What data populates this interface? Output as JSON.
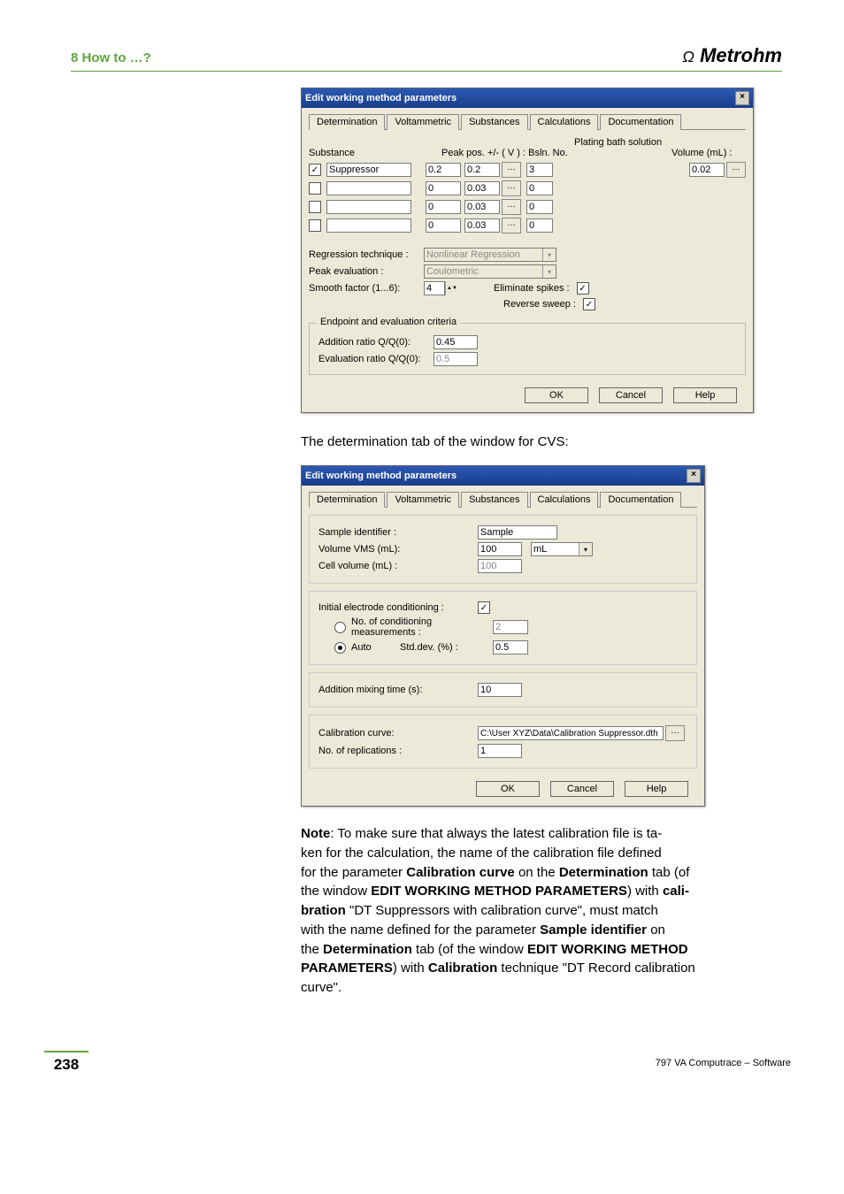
{
  "header": {
    "section": "8  How to …?",
    "brand": "Metrohm"
  },
  "dlg1": {
    "title": "Edit working method parameters",
    "tabs": [
      "Determination",
      "Voltammetric",
      "Substances",
      "Calculations",
      "Documentation"
    ],
    "active_tab": "Substances",
    "headers": {
      "substance": "Substance",
      "peakpos": "Peak pos.  +/- ( V ) : Bsln. No.",
      "plating": "Plating bath solution",
      "volume": "Volume (mL) :"
    },
    "rows": [
      {
        "chk": true,
        "name": "Suppressor",
        "p1": "0.2",
        "p2": "0.2",
        "b": "3",
        "vol": "0.02"
      },
      {
        "chk": false,
        "name": "",
        "p1": "0",
        "p2": "0.03",
        "b": "0",
        "vol": ""
      },
      {
        "chk": false,
        "name": "",
        "p1": "0",
        "p2": "0.03",
        "b": "0",
        "vol": ""
      },
      {
        "chk": false,
        "name": "",
        "p1": "0",
        "p2": "0.03",
        "b": "0",
        "vol": ""
      }
    ],
    "labels": {
      "regression": "Regression technique :",
      "regression_val": "Nonlinear Regression",
      "peak_eval": "Peak evaluation :",
      "peak_eval_val": "Coulometric",
      "smooth": "Smooth factor (1...6):",
      "smooth_val": "4",
      "elim": "Eliminate spikes :",
      "rev": "Reverse sweep :"
    },
    "group": {
      "legend": "Endpoint and evaluation criteria",
      "addition": "Addition ratio Q/Q(0):",
      "addition_val": "0.45",
      "eval": "Evaluation ratio Q/Q(0):",
      "eval_val": "0.5"
    },
    "buttons": {
      "ok": "OK",
      "cancel": "Cancel",
      "help": "Help"
    }
  },
  "caption2": "The determination tab of the window for CVS:",
  "dlg2": {
    "title": "Edit working method parameters",
    "tabs": [
      "Determination",
      "Voltammetric",
      "Substances",
      "Calculations",
      "Documentation"
    ],
    "active_tab": "Determination",
    "labels": {
      "sample_id": "Sample identifier :",
      "sample_id_val": "Sample",
      "vol_vms": "Volume VMS (mL):",
      "vol_vms_val": "100",
      "unit": "mL",
      "cell_vol": "Cell volume (mL) :",
      "cell_vol_val": "100",
      "init_cond": "Initial electrode conditioning :",
      "no_cond": "No. of  conditioning measurements :",
      "no_cond_val": "2",
      "auto": "Auto",
      "stddev": "Std.dev. (%) :",
      "stddev_val": "0.5",
      "mix": "Addition mixing time (s):",
      "mix_val": "10",
      "calcurve": "Calibration curve:",
      "calcurve_val": "C:\\User XYZ\\Data\\Calibration Suppressor.dth",
      "repl": "No. of replications :",
      "repl_val": "1"
    },
    "buttons": {
      "ok": "OK",
      "cancel": "Cancel",
      "help": "Help"
    }
  },
  "note": {
    "prefix": "Note",
    "text1": ": To make sure that always the latest calibration file is ta-",
    "text2": "ken for the calculation, the name of the calibration file defined",
    "text3": "for the parameter ",
    "calcurve": "Calibration curve",
    "text4": " on the ",
    "det": "Determination",
    "text5": " tab (of",
    "text6": "the window ",
    "win": "EDIT WORKING METHOD PARAMETERS",
    "text7": ") with ",
    "cali": "cali-",
    "text8a": "bration",
    "text8": " \"DT Suppressors with calibration curve\", must match",
    "text9": "with the name defined for the parameter ",
    "sample": "Sample identifier",
    "text10": " on",
    "text11": "the ",
    "text12": " tab (of the window ",
    "text13": ") with ",
    "calibration": "Calibration",
    "text14": " technique \"DT Record calibration",
    "text15": "curve\"."
  },
  "footer": {
    "page": "238",
    "right": "797 VA Computrace – Software"
  }
}
